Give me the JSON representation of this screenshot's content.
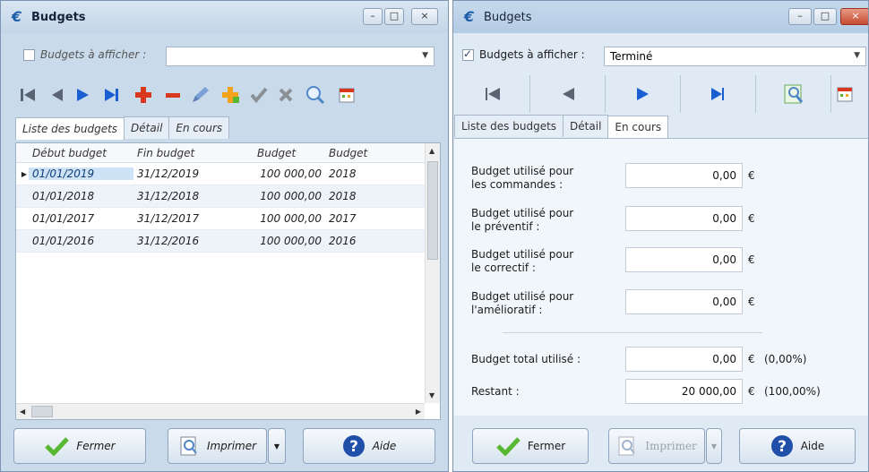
{
  "left": {
    "title": "Budgets",
    "filter_label": "Budgets à afficher :",
    "filter_value": "",
    "tabs": [
      "Liste des budgets",
      "Détail",
      "En cours"
    ],
    "columns": [
      "Début budget",
      "Fin budget",
      "Budget",
      "Budget"
    ],
    "rows": [
      [
        "01/01/2019",
        "31/12/2019",
        "100 000,00",
        "2018"
      ],
      [
        "01/01/2018",
        "31/12/2018",
        "100 000,00",
        "2018"
      ],
      [
        "01/01/2017",
        "31/12/2017",
        "100 000,00",
        "2017"
      ],
      [
        "01/01/2016",
        "31/12/2016",
        "100 000,00",
        "2016"
      ]
    ],
    "buttons": {
      "close": "Fermer",
      "print": "Imprimer",
      "help": "Aide"
    }
  },
  "right": {
    "title": "Budgets",
    "filter_label": "Budgets à afficher :",
    "filter_value": "Terminé",
    "tabs": [
      "Liste des budgets",
      "Détail",
      "En cours"
    ],
    "fields": [
      {
        "label_1": "Budget utilisé pour",
        "label_2": "les commandes :",
        "value": "0,00",
        "unit": "€"
      },
      {
        "label_1": "Budget utilisé pour",
        "label_2": "le préventif :",
        "value": "0,00",
        "unit": "€"
      },
      {
        "label_1": "Budget utilisé pour",
        "label_2": "le correctif :",
        "value": "0,00",
        "unit": "€"
      },
      {
        "label_1": "Budget utilisé pour",
        "label_2": "l'amélioratif :",
        "value": "0,00",
        "unit": "€"
      }
    ],
    "total": {
      "label": "Budget total utilisé :",
      "value": "0,00",
      "unit": "€",
      "pct": "(0,00%)"
    },
    "remaining": {
      "label": "Restant :",
      "value": "20 000,00",
      "unit": "€",
      "pct": "(100,00%)"
    },
    "buttons": {
      "close": "Fermer",
      "print": "Imprimer",
      "help": "Aide"
    }
  },
  "colors": {
    "accent": "#1c5ea8",
    "red": "#d7381e",
    "blue_arrow": "#1a5fd1",
    "green": "#58b831"
  },
  "icons": [
    "first-record-icon",
    "previous-record-icon",
    "next-record-icon",
    "last-record-icon",
    "add-icon",
    "remove-icon",
    "edit-icon",
    "duplicate-icon",
    "validate-icon",
    "cancel-icon",
    "search-icon",
    "calendar-icon",
    "check-icon",
    "print-icon",
    "help-icon"
  ]
}
